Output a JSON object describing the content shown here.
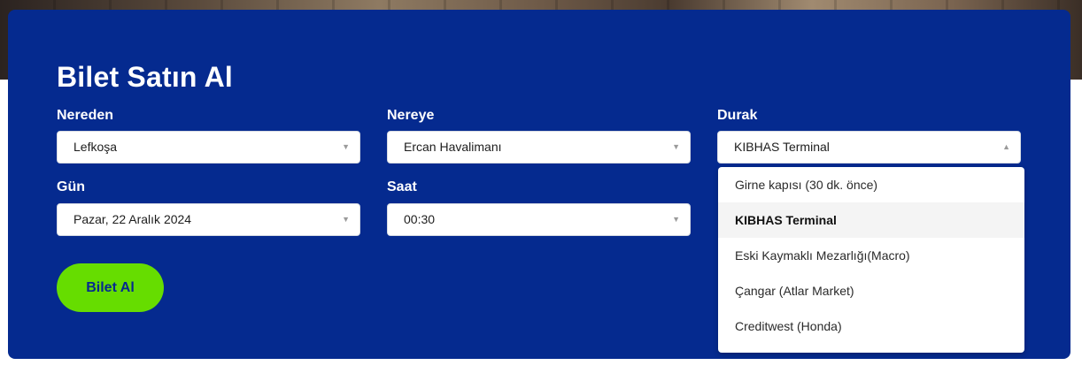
{
  "form": {
    "title": "Bilet Satın Al",
    "from": {
      "label": "Nereden",
      "value": "Lefkoşa"
    },
    "to": {
      "label": "Nereye",
      "value": "Ercan Havalimanı"
    },
    "stop": {
      "label": "Durak",
      "value": "KIBHAS Terminal",
      "options": [
        "Girne kapısı (30 dk. önce)",
        "KIBHAS Terminal",
        "Eski Kaymaklı Mezarlığı(Macro)",
        "Çangar (Atlar Market)",
        "Creditwest (Honda)"
      ],
      "selected_index": 1
    },
    "day": {
      "label": "Gün",
      "value": "Pazar, 22 Aralık 2024"
    },
    "time": {
      "label": "Saat",
      "value": "00:30"
    },
    "submit_label": "Bilet Al"
  },
  "icons": {
    "select_closed": "chevron-down-icon",
    "select_open": "chevron-up-icon"
  },
  "colors": {
    "panel": "#052a8f",
    "button": "#66dd00",
    "button_text": "#052a8f"
  }
}
